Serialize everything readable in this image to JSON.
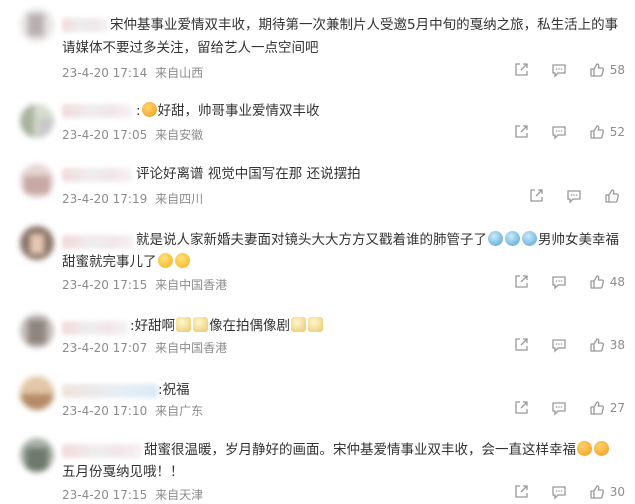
{
  "comments": [
    {
      "line1": "宋仲基事业爱情双丰收，期待第一次兼制片人受邀5月中旬的戛纳之旅，私生活上的事",
      "line2": "请媒体不要过多关注，留给艺人一点空间吧",
      "date": "23-4-20 17:14",
      "location": "来自山西",
      "likes": "58"
    },
    {
      "line1": "好甜，帅哥事业爱情双丰收",
      "date": "23-4-20 17:05",
      "location": "来自安徽",
      "likes": "52"
    },
    {
      "line1": "评论好离谱 视觉中国写在那 还说摆拍",
      "date": "23-4-20 17:19",
      "location": "来自四川",
      "likes": ""
    },
    {
      "line1": "就是说人家新婚夫妻面对镜头大大方方又戳着谁的肺管子了",
      "line1b": "男帅女美幸福",
      "line2": "甜蜜就完事儿了",
      "date": "23-4-20 17:15",
      "location": "来自中国香港",
      "likes": "48"
    },
    {
      "line1": "好甜啊",
      "line1b": "像在拍偶像剧",
      "date": "23-4-20 17:07",
      "location": "来自中国香港",
      "likes": "38"
    },
    {
      "line1": "祝福",
      "date": "23-4-20 17:10",
      "location": "来自广东",
      "likes": "27"
    },
    {
      "line1": "甜蜜很温暖，岁月静好的画面。宋仲基爱情事业双丰收，会一直这样幸福",
      "line2": "五月份戛纳见哦！！",
      "date": "23-4-20 17:15",
      "location": "来自天津",
      "likes": "30"
    }
  ],
  "colors": {
    "text": "#333333",
    "meta": "#8c8c8c",
    "icon": "#8c8c8c"
  },
  "icons": [
    "share-icon",
    "comment-icon",
    "like-icon"
  ]
}
